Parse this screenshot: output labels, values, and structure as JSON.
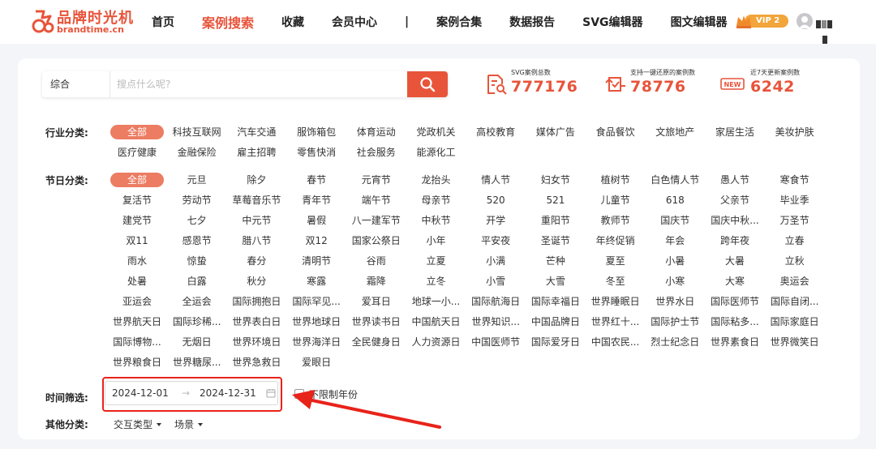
{
  "header": {
    "logo_cn": "品牌时光机",
    "logo_en": "brandtime.cn",
    "nav": [
      {
        "label": "首页",
        "active": false
      },
      {
        "label": "案例搜索",
        "active": true
      },
      {
        "label": "收藏",
        "active": false
      },
      {
        "label": "会员中心",
        "active": false
      },
      {
        "label": "|",
        "separator": true
      },
      {
        "label": "案例合集",
        "active": false
      },
      {
        "label": "数据报告",
        "active": false
      },
      {
        "label": "SVG编辑器",
        "active": false
      },
      {
        "label": "图文编辑器",
        "active": false
      }
    ],
    "vip_badge": "VIP 2"
  },
  "search": {
    "type": "综合",
    "placeholder": "搜点什么呢?"
  },
  "stats": [
    {
      "label": "SVG案例总数",
      "value": "777176",
      "icon": "svg-doc-search-icon"
    },
    {
      "label": "支持一键还原的案例数",
      "value": "78776",
      "icon": "restore-icon"
    },
    {
      "label": "近7天更新案例数",
      "value": "6242",
      "icon": "new-badge-icon"
    }
  ],
  "industry": {
    "label": "行业分类:",
    "tags": [
      "全部",
      "科技互联网",
      "汽车交通",
      "服饰箱包",
      "体育运动",
      "党政机关",
      "高校教育",
      "媒体广告",
      "食品餐饮",
      "文旅地产",
      "家居生活",
      "美妆护肤",
      "医疗健康",
      "金融保险",
      "雇主招聘",
      "零售快消",
      "社会服务",
      "能源化工"
    ]
  },
  "festival": {
    "label": "节日分类:",
    "tags": [
      "全部",
      "元旦",
      "除夕",
      "春节",
      "元宵节",
      "龙抬头",
      "情人节",
      "妇女节",
      "植树节",
      "白色情人节",
      "愚人节",
      "寒食节",
      "复活节",
      "劳动节",
      "草莓音乐节",
      "青年节",
      "端午节",
      "母亲节",
      "520",
      "521",
      "儿童节",
      "618",
      "父亲节",
      "毕业季",
      "建党节",
      "七夕",
      "中元节",
      "暑假",
      "八一建军节",
      "中秋节",
      "开学",
      "重阳节",
      "教师节",
      "国庆节",
      "国庆中秋...",
      "万圣节",
      "双11",
      "感恩节",
      "腊八节",
      "双12",
      "国家公祭日",
      "小年",
      "平安夜",
      "圣诞节",
      "年终促销",
      "年会",
      "跨年夜",
      "立春",
      "雨水",
      "惊蛰",
      "春分",
      "清明节",
      "谷雨",
      "立夏",
      "小满",
      "芒种",
      "夏至",
      "小暑",
      "大暑",
      "立秋",
      "处暑",
      "白露",
      "秋分",
      "寒露",
      "霜降",
      "立冬",
      "小雪",
      "大雪",
      "冬至",
      "小寒",
      "大寒",
      "奥运会",
      "亚运会",
      "全运会",
      "国际拥抱日",
      "国际罕见...",
      "爱耳日",
      "地球一小...",
      "国际航海日",
      "国际幸福日",
      "世界睡眠日",
      "世界水日",
      "国际医师节",
      "国际自闭...",
      "世界航天日",
      "国际珍稀...",
      "世界表白日",
      "世界地球日",
      "世界读书日",
      "中国航天日",
      "世界知识...",
      "中国品牌日",
      "世界红十...",
      "国际护士节",
      "国际粘多...",
      "国际家庭日",
      "国际博物...",
      "无烟日",
      "世界环境日",
      "世界海洋日",
      "全民健身日",
      "人力资源日",
      "中国医师节",
      "国际爱牙日",
      "中国农民...",
      "烈士纪念日",
      "世界素食日",
      "世界微笑日",
      "世界粮食日",
      "世界糖尿...",
      "世界急救日",
      "爱眼日"
    ]
  },
  "time": {
    "label": "时间筛选:",
    "start": "2024-12-01",
    "arrow": "→",
    "end": "2024-12-31",
    "no_limit_label": "不限制年份"
  },
  "other": {
    "label": "其他分类:",
    "dropdowns": [
      "交互类型",
      "场景"
    ]
  },
  "colors": {
    "accent": "#e8543a",
    "tag_active": "#ec7c62",
    "annotation_red": "#e8231a"
  }
}
